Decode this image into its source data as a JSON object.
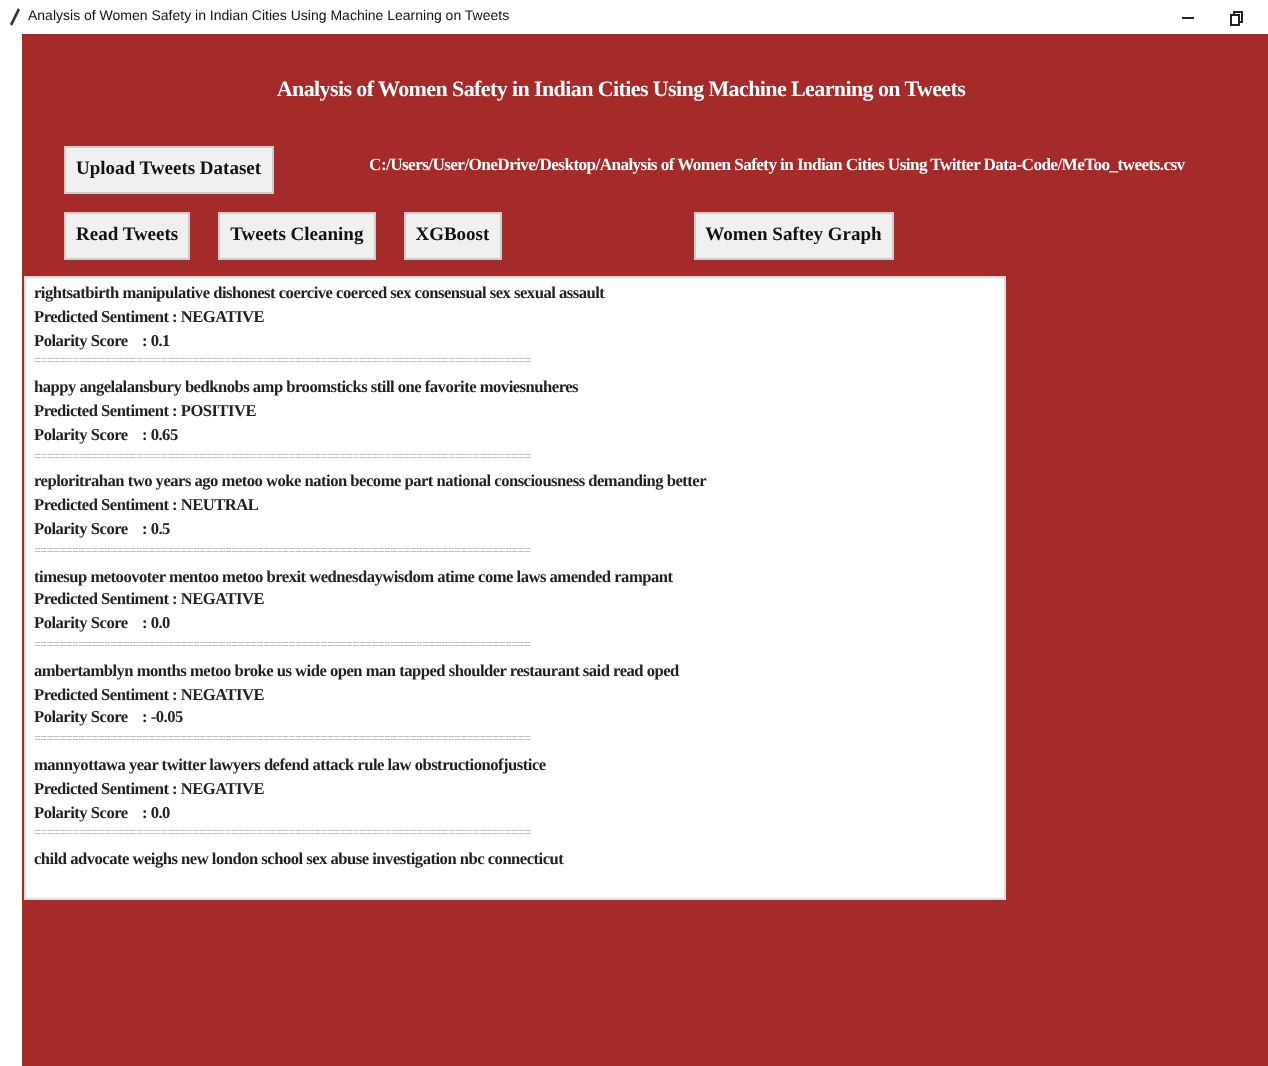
{
  "window": {
    "title": "Analysis of Women Safety in Indian Cities Using Machine Learning on Tweets"
  },
  "heading": "Analysis of Women Safety in Indian Cities Using Machine Learning on Tweets",
  "upload_button": "Upload Tweets Dataset",
  "file_path": "C:/Users/User/OneDrive/Desktop/Analysis of Women Safety in Indian Cities Using Twitter Data-Code/MeToo_tweets.csv",
  "buttons": [
    {
      "label": "Read Tweets",
      "kind": "action"
    },
    {
      "label": "Tweets Cleaning",
      "kind": "action"
    },
    {
      "label": "XGBoost",
      "kind": "action"
    },
    {
      "label": "Women Saftey Graph",
      "kind": "graph"
    }
  ],
  "output": [
    {
      "kind": "tweet",
      "text": "rightsatbirth manipulative dishonest coercive coerced sex consensual sex sexual assault"
    },
    {
      "kind": "sentiment",
      "text": "Predicted Sentiment : NEGATIVE"
    },
    {
      "kind": "score",
      "label": "Polarity Score",
      "text": ": 0.1"
    },
    {
      "kind": "separator",
      "text": "=============================================================================="
    },
    {
      "kind": "tweet",
      "text": "happy angelalansbury bedknobs amp broomsticks still one favorite moviesnuheres"
    },
    {
      "kind": "sentiment",
      "text": "Predicted Sentiment : POSITIVE"
    },
    {
      "kind": "score",
      "label": "Polarity Score",
      "text": ": 0.65"
    },
    {
      "kind": "separator",
      "text": "=============================================================================="
    },
    {
      "kind": "tweet",
      "text": "reploritrahan two years ago metoo woke nation become part national consciousness demanding better"
    },
    {
      "kind": "sentiment",
      "text": "Predicted Sentiment : NEUTRAL"
    },
    {
      "kind": "score",
      "label": "Polarity Score",
      "text": ": 0.5"
    },
    {
      "kind": "separator",
      "text": "=============================================================================="
    },
    {
      "kind": "tweet",
      "text": "timesup metoovoter mentoo metoo brexit wednesdaywisdom atime come laws amended rampant"
    },
    {
      "kind": "sentiment",
      "text": "Predicted Sentiment : NEGATIVE"
    },
    {
      "kind": "score",
      "label": "Polarity Score",
      "text": ": 0.0"
    },
    {
      "kind": "separator",
      "text": "=============================================================================="
    },
    {
      "kind": "tweet",
      "text": "ambertamblyn months metoo broke us wide open man tapped shoulder restaurant said read oped"
    },
    {
      "kind": "sentiment",
      "text": "Predicted Sentiment : NEGATIVE"
    },
    {
      "kind": "score",
      "label": "Polarity Score",
      "text": ": -0.05"
    },
    {
      "kind": "separator",
      "text": "=============================================================================="
    },
    {
      "kind": "tweet",
      "text": "mannyottawa year twitter lawyers defend attack rule law obstructionofjustice"
    },
    {
      "kind": "sentiment",
      "text": "Predicted Sentiment : NEGATIVE"
    },
    {
      "kind": "score",
      "label": "Polarity Score",
      "text": ": 0.0"
    },
    {
      "kind": "separator",
      "text": "=============================================================================="
    },
    {
      "kind": "tweet",
      "text": "child advocate weighs new london school sex abuse investigation nbc connecticut"
    }
  ]
}
